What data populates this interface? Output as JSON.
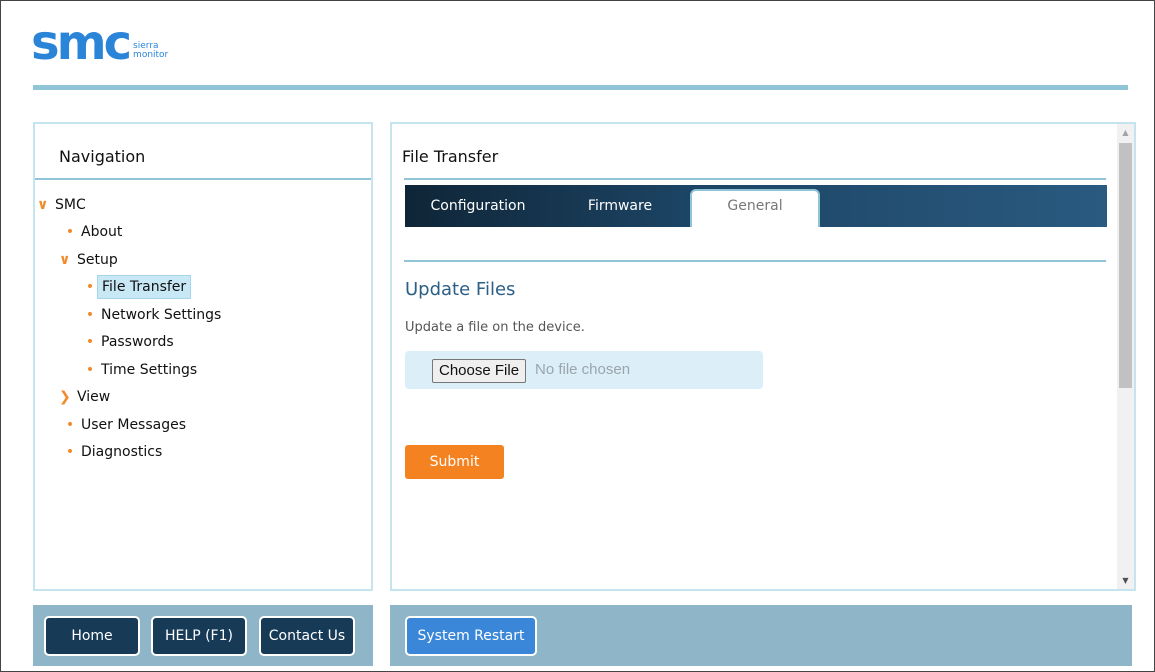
{
  "logo": {
    "brand": "smc",
    "sub_line1": "sierra",
    "sub_line2": "monitor"
  },
  "colors": {
    "accent_orange": "#f58220",
    "accent_blue": "#2a84d8",
    "rule": "#8fc5d6",
    "footer": "#8fb6c8",
    "nav_dark": "#173a57"
  },
  "navigation": {
    "title": "Navigation",
    "items": [
      {
        "label": "SMC",
        "icon": "chevron-down-icon",
        "level": 0
      },
      {
        "label": "About",
        "icon": "bullet-icon",
        "level": 1
      },
      {
        "label": "Setup",
        "icon": "chevron-down-icon",
        "level": 1
      },
      {
        "label": "File Transfer",
        "icon": "bullet-icon",
        "level": 2,
        "selected": true
      },
      {
        "label": "Network Settings",
        "icon": "bullet-icon",
        "level": 2
      },
      {
        "label": "Passwords",
        "icon": "bullet-icon",
        "level": 2
      },
      {
        "label": "Time Settings",
        "icon": "bullet-icon",
        "level": 2
      },
      {
        "label": "View",
        "icon": "chevron-right-icon",
        "level": 1
      },
      {
        "label": "User Messages",
        "icon": "bullet-icon",
        "level": 1
      },
      {
        "label": "Diagnostics",
        "icon": "bullet-icon",
        "level": 1
      }
    ]
  },
  "main": {
    "title": "File Transfer",
    "tabs": [
      {
        "label": "Configuration"
      },
      {
        "label": "Firmware"
      },
      {
        "label": "General",
        "active": true
      }
    ],
    "section_title": "Update Files",
    "section_desc": "Update a file on the device.",
    "choose_file_label": "Choose File",
    "no_file_text": "No file chosen",
    "submit_label": "Submit"
  },
  "footer": {
    "home_label": "Home",
    "help_label": "HELP (F1)",
    "contact_label": "Contact Us",
    "restart_label": "System Restart"
  }
}
